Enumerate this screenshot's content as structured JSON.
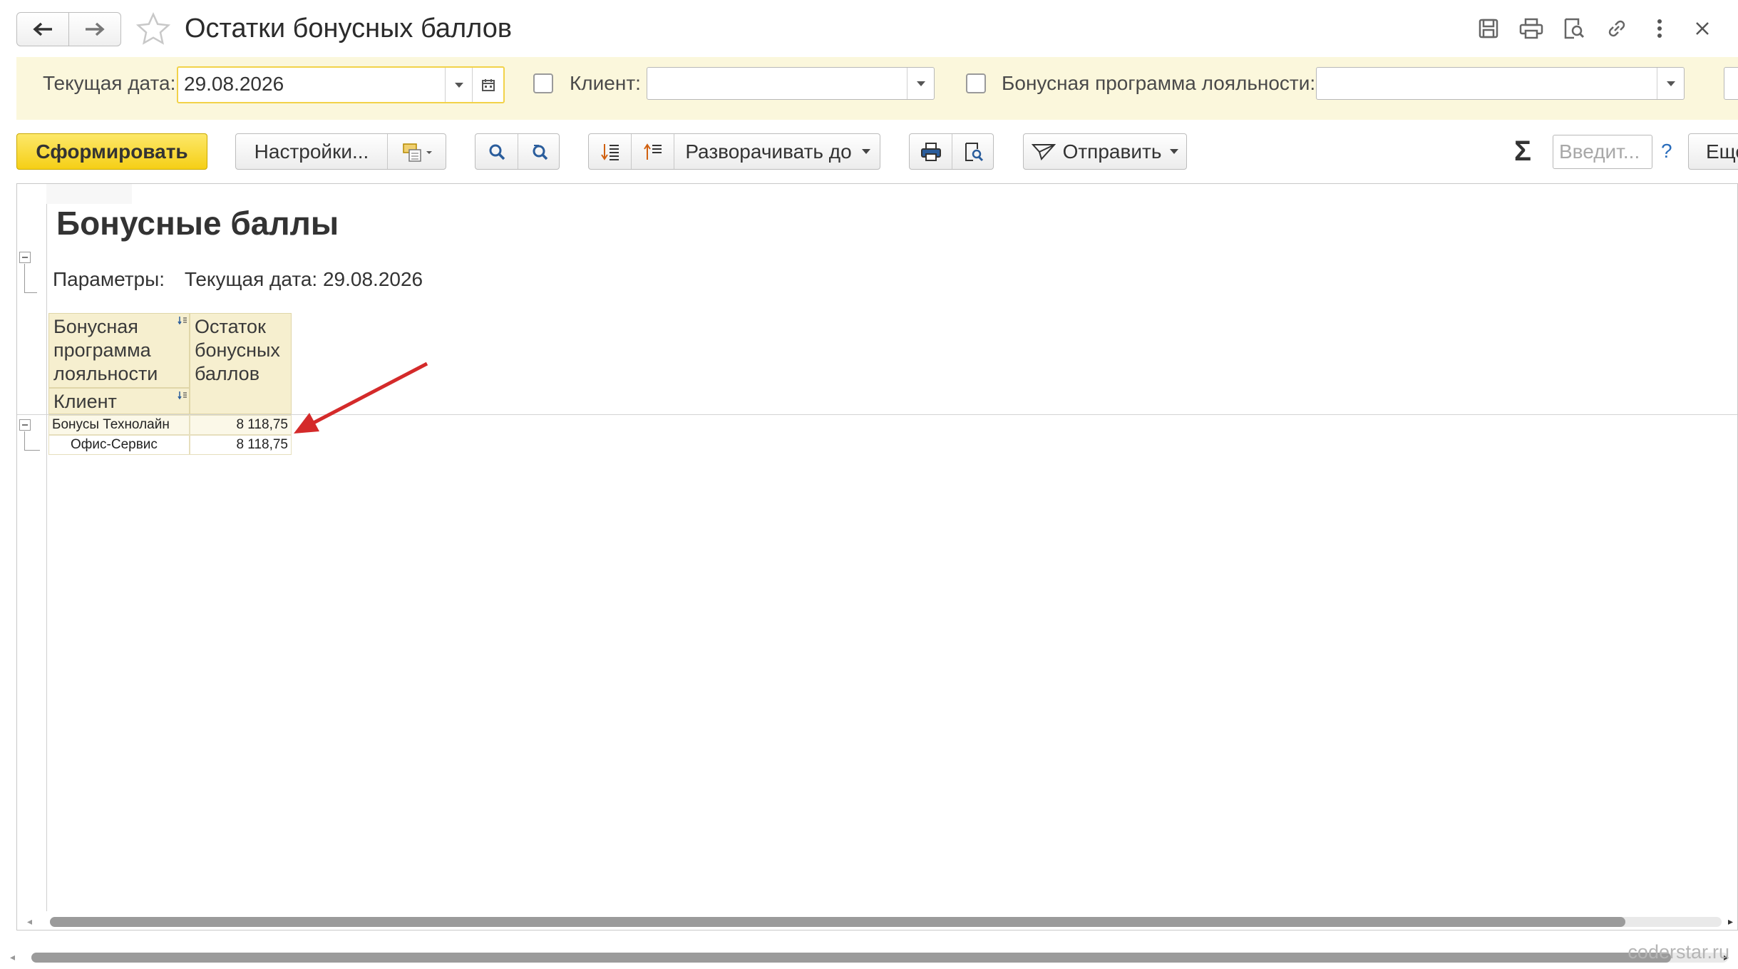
{
  "window": {
    "title": "Остатки бонусных баллов",
    "back_icon": "arrow-left-icon",
    "forward_icon": "arrow-right-icon",
    "favorite_icon": "star-icon"
  },
  "title_actions": [
    "save-icon",
    "print-icon",
    "preview-icon",
    "link-icon",
    "more-icon",
    "close-icon"
  ],
  "filters": {
    "current_date_label": "Текущая дата:",
    "current_date_value": "29.08.2026",
    "client_label": "Клиент:",
    "client_value": "",
    "client_checked": false,
    "loyalty_label": "Бонусная программа лояльности:",
    "loyalty_value": "",
    "loyalty_checked": false
  },
  "toolbar": {
    "generate": "Сформировать",
    "settings": "Настройки...",
    "expand_to": "Разворачивать до",
    "send": "Отправить",
    "search_placeholder": "Введит...",
    "help": "?",
    "more": "Еще",
    "sum_symbol": "Σ"
  },
  "report": {
    "heading": "Бонусные баллы",
    "params_label": "Параметры:",
    "params_value": "Текущая дата: 29.08.2026",
    "columns": {
      "program_header": "Бонусная программа лояльности",
      "client_header": "Клиент",
      "balance_header": "Остаток бонусных баллов"
    },
    "rows": [
      {
        "name": "Бонусы Технолайн",
        "value": "8 118,75",
        "level": 0
      },
      {
        "name": "Офис-Сервис",
        "value": "8 118,75",
        "level": 1
      }
    ]
  },
  "colors": {
    "accent_yellow": "#f5cf16",
    "filter_bg": "#fbf7dc",
    "header_cell_bg": "#f6efcf",
    "arrow_red": "#d42a2a"
  },
  "watermark": "coderstar.ru"
}
